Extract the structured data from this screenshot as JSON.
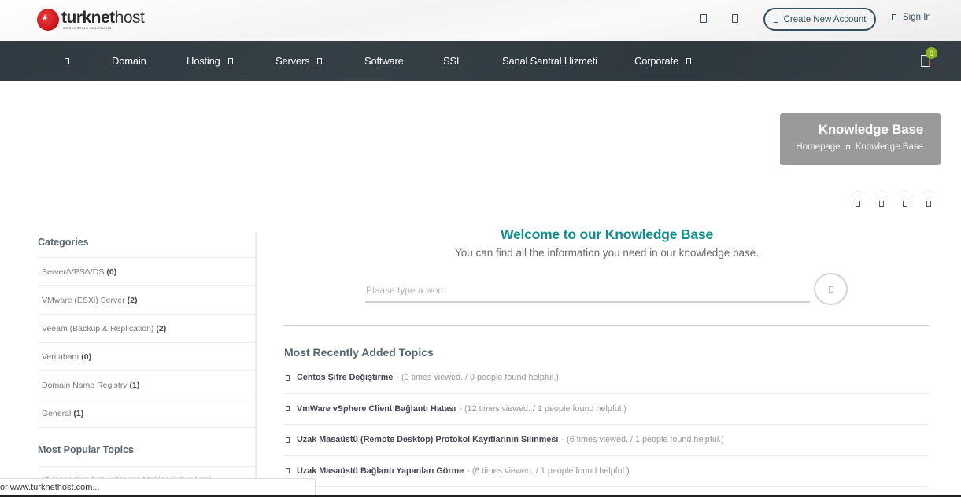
{
  "header": {
    "logo": {
      "word_bold": "turknet",
      "word_light": "host",
      "tagline": "WEBHOSTING SOLUTIONS"
    },
    "icons": [
      "phone-icon",
      "envelope-icon"
    ],
    "create_account": {
      "label": "Create New Account",
      "icon": "user-plus-icon"
    },
    "sign_in": {
      "label": "Sign In",
      "icon": "lock-icon"
    }
  },
  "nav": {
    "items": [
      {
        "label": "",
        "icon": "home-icon",
        "has_caret": false
      },
      {
        "label": "Domain",
        "has_caret": false
      },
      {
        "label": "Hosting",
        "has_caret": true
      },
      {
        "label": "Servers",
        "has_caret": true
      },
      {
        "label": "Software",
        "has_caret": false
      },
      {
        "label": "SSL",
        "has_caret": false
      },
      {
        "label": "Sanal Santral Hizmeti",
        "has_caret": false
      },
      {
        "label": "Corporate",
        "has_caret": true
      }
    ],
    "cart": {
      "count": "0",
      "icon": "shopping-bag-icon",
      "badge_color": "#8db31f"
    }
  },
  "page_title": {
    "title": "Knowledge Base",
    "breadcrumb": [
      "Homepage",
      "Knowledge Base"
    ]
  },
  "share": [
    "facebook-icon",
    "twitter-icon",
    "linkedin-icon",
    "email-icon"
  ],
  "sidebar": {
    "categories_title": "Categories",
    "categories": [
      {
        "name": "Server/VPS/VDS",
        "count": "(0)"
      },
      {
        "name": "VMware (ESXi) Server",
        "count": "(2)"
      },
      {
        "name": "Veeam (Backup & Replication)",
        "count": "(2)"
      },
      {
        "name": "Veritabanı",
        "count": "(0)"
      },
      {
        "name": "Domain Name Registry",
        "count": "(1)"
      },
      {
        "name": "General",
        "count": "(1)"
      }
    ],
    "popular_title": "Most Popular Topics",
    "popular_first": "pfSense Kurulum (pfSense Makinesi Kurulum)"
  },
  "main": {
    "welcome_title": "Welcome to our Knowledge Base",
    "welcome_subtitle": "You can find all the information you need in our knowledge base.",
    "search": {
      "placeholder": "Please type a word",
      "value": ""
    },
    "recent_title": "Most Recently Added Topics",
    "topics": [
      {
        "title": "Centos Şifre Değiştirme",
        "meta": "- (0 times viewed. / 0 people found helpful.)"
      },
      {
        "title": "VmWare vSphere Client Bağlantı Hatası",
        "meta": "- (12 times viewed. / 1 people found helpful.)"
      },
      {
        "title": "Uzak Masaüstü (Remote Desktop) Protokol Kayıtlarının Silinmesi",
        "meta": "- (6 times viewed. / 1 people found helpful.)"
      },
      {
        "title": "Uzak Masaüstü Bağlantı Yapanları Görme",
        "meta": "- (6 times viewed. / 1 people found helpful.)"
      }
    ]
  },
  "status_bar": {
    "text": "or www.turknethost.com..."
  },
  "colors": {
    "accent": "#138c8c",
    "nav_bg": "#323c43",
    "title_box": "#9a9a9a",
    "badge": "#8db31f"
  }
}
